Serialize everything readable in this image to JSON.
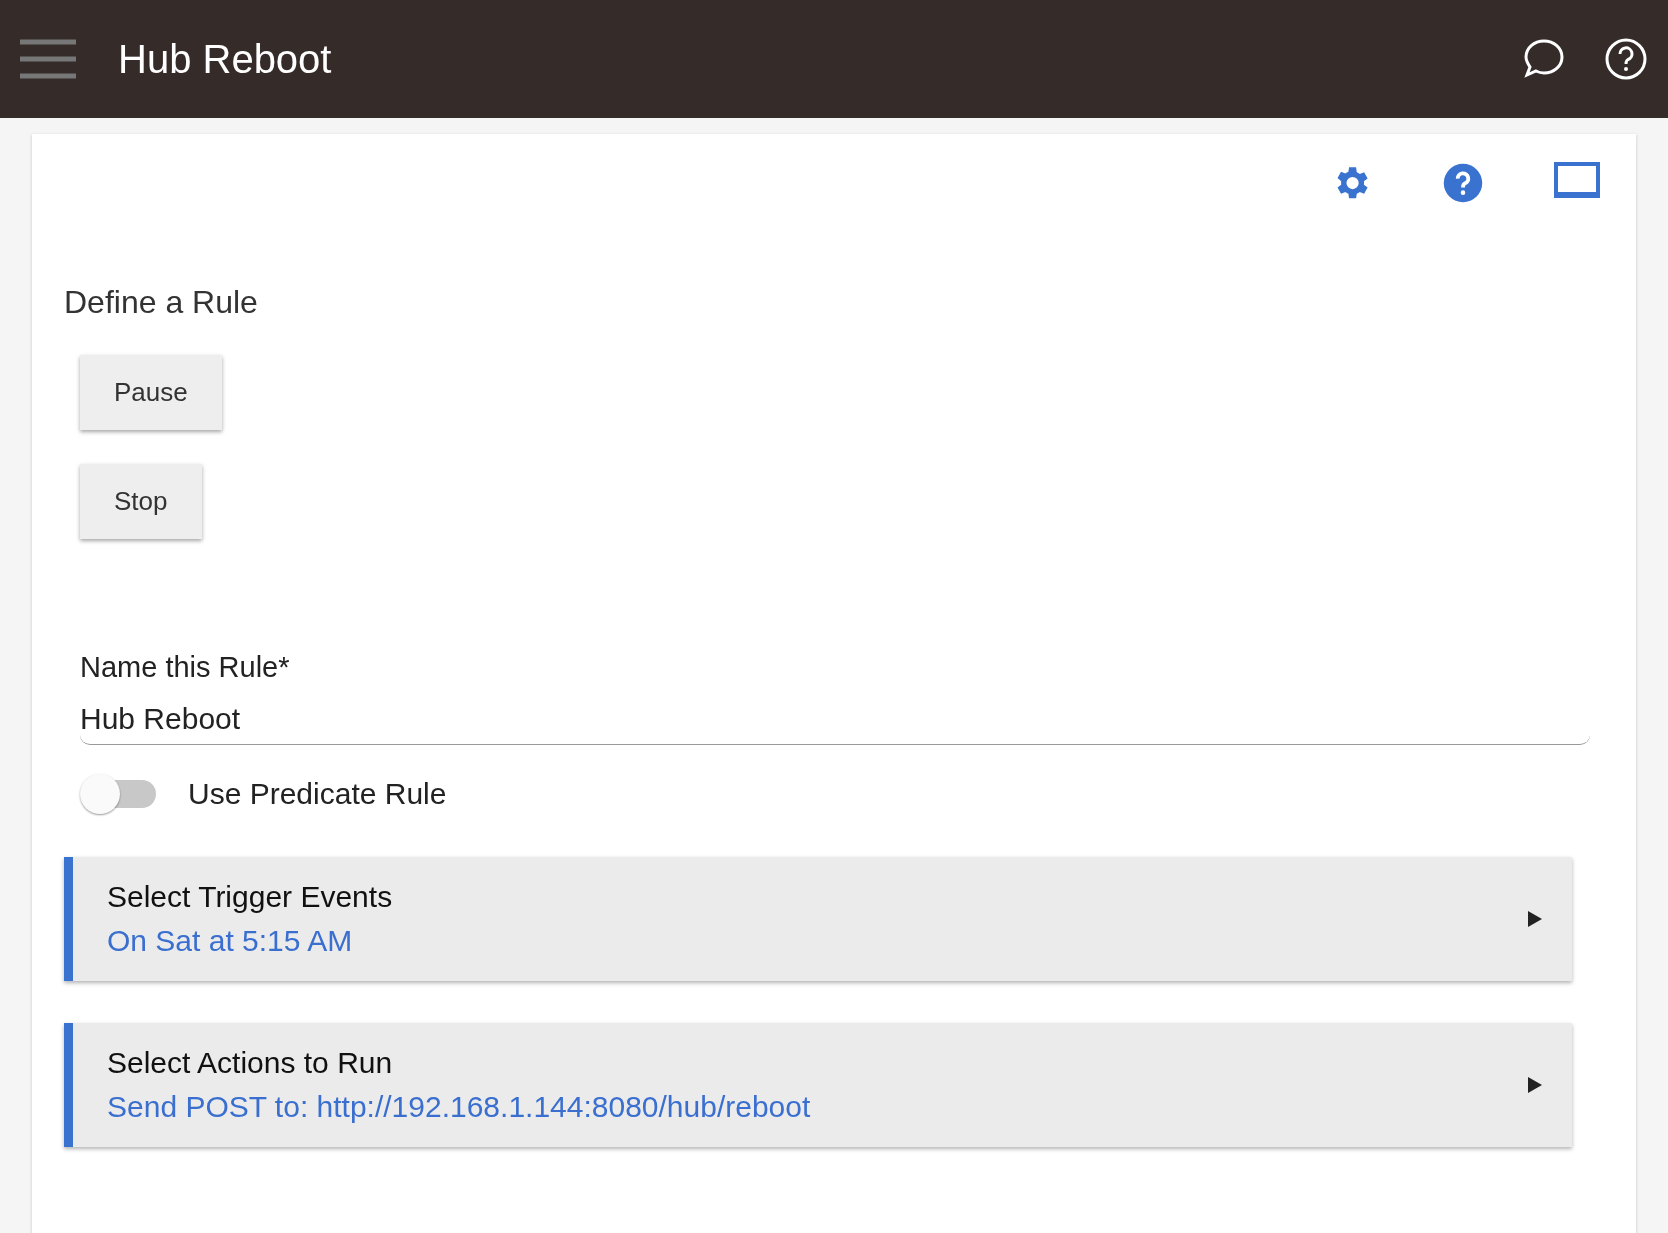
{
  "header": {
    "title": "Hub Reboot"
  },
  "page": {
    "heading": "Define a Rule"
  },
  "buttons": [
    "Pause",
    "Stop"
  ],
  "name_field": {
    "label": "Name this Rule*",
    "value": "Hub Reboot"
  },
  "predicate_toggle": {
    "label": "Use Predicate Rule",
    "on": false
  },
  "sections": [
    {
      "title": "Select Trigger Events",
      "summary": "On Sat at 5:15 AM"
    },
    {
      "title": "Select Actions to Run",
      "summary": "Send POST to: http://192.168.1.144:8080/hub/reboot"
    }
  ]
}
